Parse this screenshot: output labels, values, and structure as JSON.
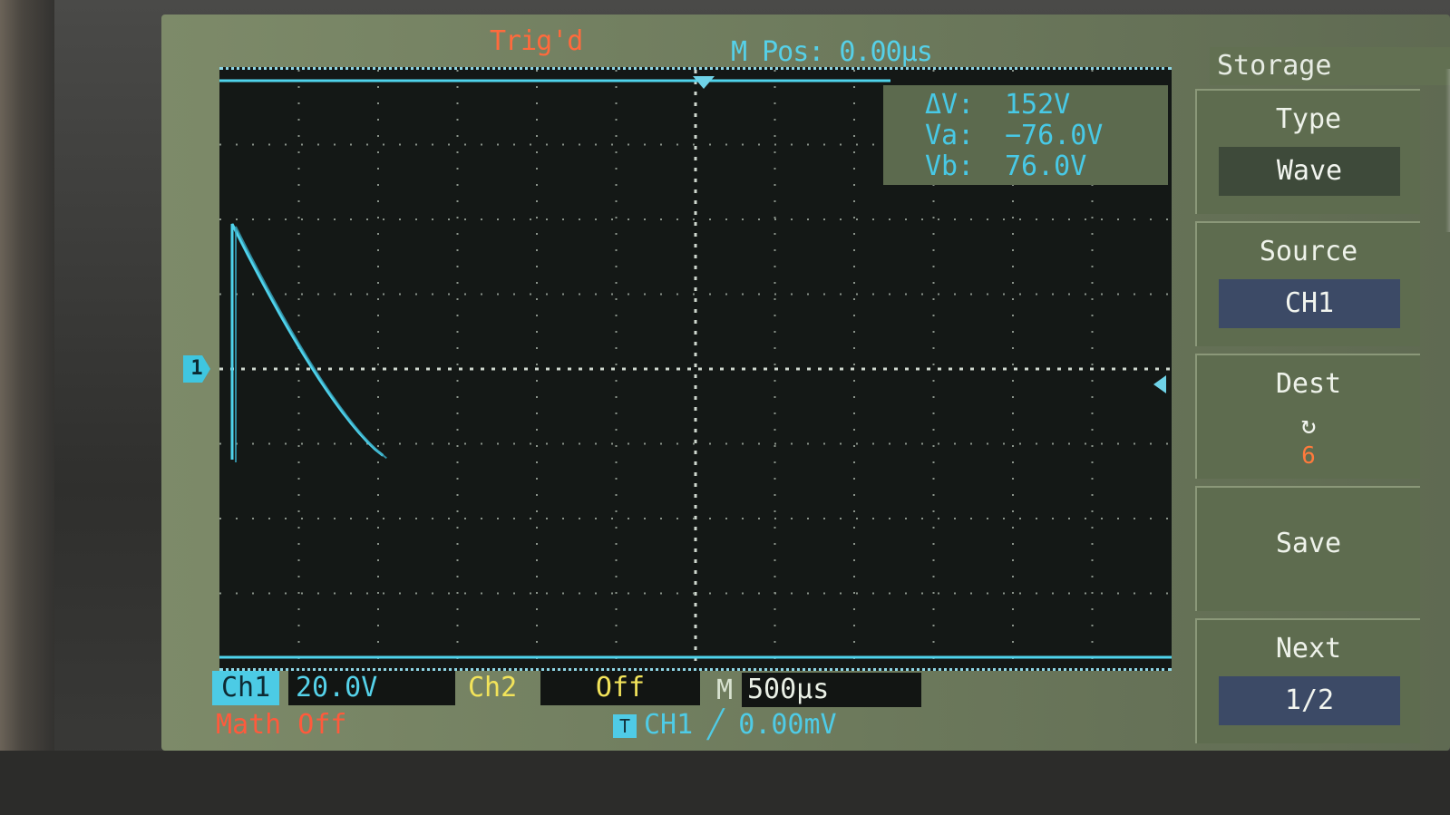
{
  "header": {
    "trigger_status": "Trig'd",
    "m_pos": "M Pos: 0.00µs"
  },
  "measurement": {
    "delta_v_label": "ΔV:",
    "delta_v_value": "152V",
    "va_label": "Va:",
    "va_value": "−76.0V",
    "vb_label": "Vb:",
    "vb_value": "76.0V"
  },
  "channels": {
    "ch1_label": "Ch1",
    "ch1_scale": "20.0V",
    "ch2_label": "Ch2",
    "ch2_scale": "Off",
    "m_label": "M",
    "timebase": "500µs",
    "math": "Math Off"
  },
  "trigger_info": {
    "icon": "T",
    "source": "CH1",
    "slope": "╱",
    "level": "0.00mV"
  },
  "ch1_marker": "1",
  "menu": {
    "title": "Storage",
    "items": [
      {
        "label": "Type",
        "value": "Wave"
      },
      {
        "label": "Source",
        "value": "CH1"
      },
      {
        "label": "Dest",
        "icon": "↻",
        "value": "6"
      },
      {
        "label": "Save"
      },
      {
        "label": "Next",
        "value": "1/2"
      }
    ]
  },
  "colors": {
    "trace": "#4fd3ec",
    "trig_text": "#ff6a3c",
    "ch2": "#f2e35a"
  }
}
